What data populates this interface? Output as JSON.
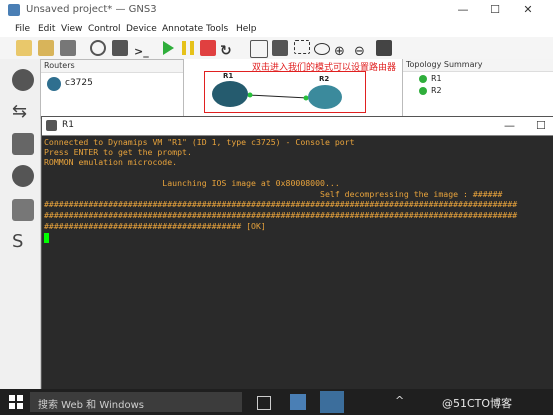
{
  "window": {
    "title": "Unsaved project* — GNS3"
  },
  "menu": [
    "File",
    "Edit",
    "View",
    "Control",
    "Device",
    "Annotate",
    "Tools",
    "Help"
  ],
  "routers_panel": {
    "title": "Routers",
    "item": "c3725"
  },
  "canvas": {
    "annotation": "双击进入我们的模式可以设置路由器",
    "r1": "R1",
    "r2": "R2"
  },
  "summary_panel": {
    "title": "Topology Summary",
    "nodes": [
      "R1",
      "R2"
    ]
  },
  "console": {
    "title": "R1",
    "lines": [
      "Connected to Dynamips VM \"R1\" (ID 1, type c3725) - Console port",
      "Press ENTER to get the prompt.",
      "ROMMON emulation microcode.",
      "",
      "                        Launching IOS image at 0x80008000...",
      "                                                        Self decompressing the image : ######",
      "################################################################################################",
      "################################################################################################",
      "######################################## [OK]"
    ]
  },
  "taskbar": {
    "search_placeholder": "搜索 Web 和 Windows",
    "watermark": "@51CTO博客"
  },
  "colors": {
    "console_bg": "#2a2a2a",
    "console_text": "#e8a33c",
    "annotation_red": "#e02020",
    "cursor": "#00ff00"
  }
}
